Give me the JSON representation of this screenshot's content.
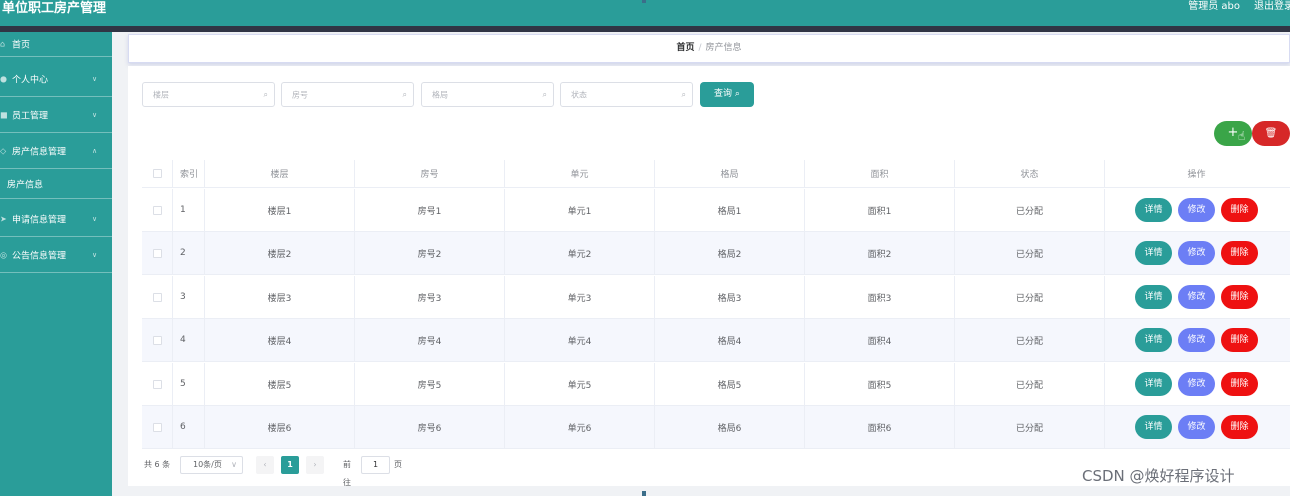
{
  "header": {
    "app_title": "单位职工房产管理",
    "admin_label": "管理员 abo",
    "logout_label": "退出登录"
  },
  "sidebar": {
    "items": [
      {
        "label": "首页",
        "icon": "home-icon"
      },
      {
        "label": "个人中心",
        "icon": "user-icon"
      },
      {
        "label": "员工管理",
        "icon": "staff-icon"
      },
      {
        "label": "房产信息管理",
        "icon": "house-icon"
      },
      {
        "label": "申请信息管理",
        "icon": "send-icon"
      },
      {
        "label": "公告信息管理",
        "icon": "notice-icon"
      }
    ],
    "sub_items": [
      {
        "label": "房产信息"
      }
    ]
  },
  "breadcrumb": {
    "home": "首页",
    "separator": "/",
    "current": "房产信息"
  },
  "search": {
    "floor_placeholder": "楼层",
    "room_placeholder": "房号",
    "layout_placeholder": "格局",
    "status_placeholder": "状态",
    "query_label": "查询 ⌕"
  },
  "toolbar": {
    "add_label": "+",
    "delete_label": "🗑"
  },
  "table": {
    "columns": [
      "索引",
      "楼层",
      "房号",
      "单元",
      "格局",
      "面积",
      "状态",
      "操作"
    ],
    "rows": [
      {
        "index": "1",
        "floor": "楼层1",
        "room": "房号1",
        "unit": "单元1",
        "layout": "格局1",
        "area": "面积1",
        "status": "已分配"
      },
      {
        "index": "2",
        "floor": "楼层2",
        "room": "房号2",
        "unit": "单元2",
        "layout": "格局2",
        "area": "面积2",
        "status": "已分配"
      },
      {
        "index": "3",
        "floor": "楼层3",
        "room": "房号3",
        "unit": "单元3",
        "layout": "格局3",
        "area": "面积3",
        "status": "已分配"
      },
      {
        "index": "4",
        "floor": "楼层4",
        "room": "房号4",
        "unit": "单元4",
        "layout": "格局4",
        "area": "面积4",
        "status": "已分配"
      },
      {
        "index": "5",
        "floor": "楼层5",
        "room": "房号5",
        "unit": "单元5",
        "layout": "格局5",
        "area": "面积5",
        "status": "已分配"
      },
      {
        "index": "6",
        "floor": "楼层6",
        "room": "房号6",
        "unit": "单元6",
        "layout": "格局6",
        "area": "面积6",
        "status": "已分配"
      }
    ],
    "action_labels": {
      "detail": "详情",
      "edit": "修改",
      "delete": "删除"
    }
  },
  "pagination": {
    "total": "共 6 条",
    "page_size": "10条/页",
    "current_page": "1",
    "goto_label": "前往",
    "goto_value": "1",
    "page_unit": "页"
  },
  "watermark": "CSDN @焕好程序设计",
  "colors": {
    "primary": "#2a9d99",
    "edit": "#6c7ef5",
    "danger": "#ee1111",
    "add": "#3aa548"
  }
}
